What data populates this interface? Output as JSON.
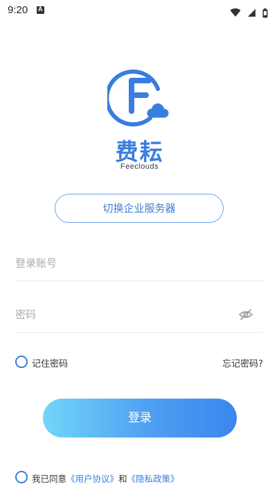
{
  "status_bar": {
    "time": "9:20",
    "icons": [
      "notification-a-icon",
      "wifi-icon",
      "signal-icon",
      "battery-icon"
    ]
  },
  "brand": {
    "name_cn": "费耘",
    "name_en": "Feeclouds",
    "accent_color": "#3a7de0"
  },
  "server_switch": {
    "label": "切换企业服务器"
  },
  "form": {
    "account_placeholder": "登录账号",
    "account_value": "",
    "password_placeholder": "密码",
    "password_value": "",
    "remember_label": "记住密码",
    "forgot_label": "忘记密码?"
  },
  "login_button": {
    "label": "登录"
  },
  "agreement": {
    "prefix": "我已同意",
    "user_agreement": "《用户协议》",
    "conjunction": "和",
    "privacy_policy": "《隐私政策》"
  }
}
